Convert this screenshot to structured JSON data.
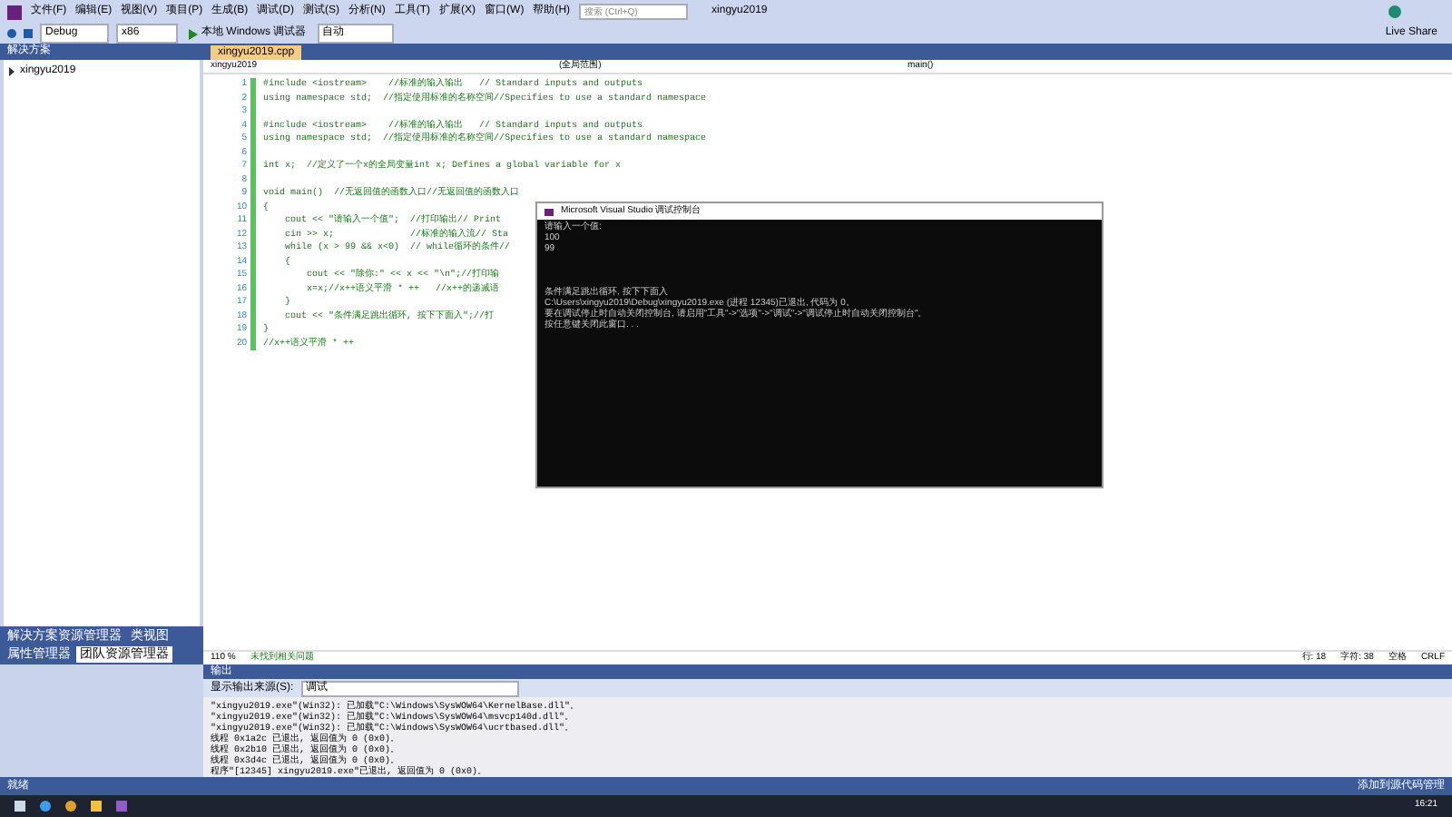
{
  "menu": [
    "文件(F)",
    "编辑(E)",
    "视图(V)",
    "项目(P)",
    "生成(B)",
    "调试(D)",
    "测试(S)",
    "分析(N)",
    "工具(T)",
    "扩展(X)",
    "窗口(W)",
    "帮助(H)"
  ],
  "search": {
    "placeholder": "搜索 (Ctrl+Q)"
  },
  "project_name": "xingyu2019",
  "live_share": "Live Share",
  "toolbar": {
    "config": "Debug",
    "platform": "x86",
    "debugger": "本地 Windows 调试器",
    "mode": "自动"
  },
  "solution_explorer": {
    "title": "解决方案",
    "root": {
      "label": "xingyu2019",
      "expanded": false
    }
  },
  "left_tabs": [
    {
      "label": "解决方案资源管理器",
      "selected": false
    },
    {
      "label": "类视图",
      "selected": false
    },
    {
      "label": "属性管理器",
      "selected": false
    },
    {
      "label": "团队资源管理器",
      "selected": true
    }
  ],
  "editor": {
    "tab": "xingyu2019.cpp",
    "scope": "xingyu2019",
    "member": "(全局范围)",
    "function": "main()",
    "lines": [
      {
        "n": "1",
        "code": "#include <iostream>    //标准的输入输出   // Standard inputs and outputs"
      },
      {
        "n": "2",
        "code": "using namespace std;  //指定使用标准的名称空间//Specifies to use a standard namespace"
      },
      {
        "n": "3"
      },
      {
        "n": "4",
        "code": "#include <iostream>    //标准的输入输出   // Standard inputs and outputs"
      },
      {
        "n": "5",
        "code": "using namespace std;  //指定使用标准的名称空间//Specifies to use a standard namespace"
      },
      {
        "n": "6"
      },
      {
        "n": "7",
        "code": "int x;  //定义了一个x的全局变量int x; Defines a global variable for x"
      },
      {
        "n": "8"
      },
      {
        "n": "9",
        "code": "void main()  //无返回值的函数入口//无返回值的函数入口"
      },
      {
        "n": "10",
        "code": "{"
      },
      {
        "n": "11",
        "code": "    cout << \"请输入一个值\";  //打印输出// Print"
      },
      {
        "n": "12",
        "code": "    cin >> x;              //标准的输入流// Sta"
      },
      {
        "n": "13",
        "code": "    while (x > 99 && x<0)  // while循环的条件//"
      },
      {
        "n": "14",
        "code": "    {"
      },
      {
        "n": "15",
        "code": "        cout << \"除你:\" << x << \"\\n\";//打印输"
      },
      {
        "n": "16",
        "code": "        x=x;//x++语义平滑 * ++   //x++的递减语"
      },
      {
        "n": "17",
        "code": "    }"
      },
      {
        "n": "18",
        "code": "    cout << \"条件满足跳出循环, 按下下面入\";//打"
      },
      {
        "n": "19",
        "code": "}"
      },
      {
        "n": "20",
        "code": "//x++语义平滑 * ++"
      }
    ],
    "zoom": "110 %",
    "status": "未找到相关问题",
    "position": [
      "行: 18",
      "字符: 38",
      "空格",
      "CRLF"
    ]
  },
  "console": {
    "title": "Microsoft Visual Studio 调试控制台",
    "lines": [
      "请输入一个值:",
      "100",
      "99",
      "条件满足跳出循环, 按下下面入",
      "C:\\Users\\xingyu2019\\Debug\\xingyu2019.exe (进程 12345)已退出, 代码为 0。",
      "要在调试停止时自动关闭控制台, 请启用\"工具\"->\"选项\"->\"调试\"->\"调试停止时自动关闭控制台\"。",
      "按任意键关闭此窗口. . ."
    ]
  },
  "output": {
    "title": "输出",
    "source_label": "显示输出来源(S):",
    "source": "调试",
    "lines": [
      "\"xingyu2019.exe\"(Win32): 已加载\"C:\\Windows\\SysWOW64\\KernelBase.dll\"。",
      "\"xingyu2019.exe\"(Win32): 已加载\"C:\\Windows\\SysWOW64\\msvcp140d.dll\"。",
      "\"xingyu2019.exe\"(Win32): 已加载\"C:\\Windows\\SysWOW64\\ucrtbased.dll\"。",
      "线程 0x1a2c 已退出, 返回值为 0 (0x0)。",
      "线程 0x2b10 已退出, 返回值为 0 (0x0)。",
      "线程 0x3d4c 已退出, 返回值为 0 (0x0)。",
      "程序\"[12345] xingyu2019.exe\"已退出, 返回值为 0 (0x0)。"
    ]
  },
  "status_bar": {
    "left": "就绪",
    "right": "添加到源代码管理"
  },
  "taskbar": {
    "time": "16:21"
  }
}
